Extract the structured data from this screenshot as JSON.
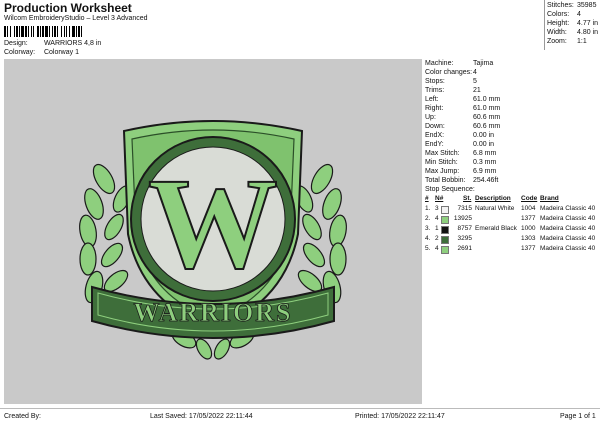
{
  "header": {
    "title": "Production Worksheet",
    "subtitle": "Wilcom EmbroideryStudio – Level 3 Advanced",
    "design_label": "Design:",
    "design_value": "WARRIORS 4,8 in",
    "colorway_label": "Colorway:",
    "colorway_value": "Colorway 1"
  },
  "stats": [
    {
      "label": "Stitches:",
      "value": "35985"
    },
    {
      "label": "Colors:",
      "value": "4"
    },
    {
      "label": "Height:",
      "value": "4.77 in"
    },
    {
      "label": "Width:",
      "value": "4.80 in"
    },
    {
      "label": "Zoom:",
      "value": "1:1"
    }
  ],
  "machine_info": [
    {
      "label": "Machine:",
      "value": "Tajima"
    },
    {
      "label": "Color changes:",
      "value": "4"
    },
    {
      "label": "Stops:",
      "value": "5"
    },
    {
      "label": "Trims:",
      "value": "21"
    },
    {
      "label": "Left:",
      "value": "61.0 mm"
    },
    {
      "label": "Right:",
      "value": "61.0 mm"
    },
    {
      "label": "Up:",
      "value": "60.6 mm"
    },
    {
      "label": "Down:",
      "value": "60.6 mm"
    },
    {
      "label": "EndX:",
      "value": "0.00 in"
    },
    {
      "label": "EndY:",
      "value": "0.00 in"
    },
    {
      "label": "Max Stitch:",
      "value": "6.8 mm"
    },
    {
      "label": "Min Stitch:",
      "value": "0.3 mm"
    },
    {
      "label": "Max Jump:",
      "value": "6.9 mm"
    },
    {
      "label": "Total Bobbin:",
      "value": "254.46ft"
    }
  ],
  "stop_sequence": {
    "title": "Stop Sequence:",
    "headers": {
      "num": "#",
      "n": "N#",
      "st": "St.",
      "description": "Description",
      "code": "Code",
      "brand": "Brand"
    },
    "rows": [
      {
        "num": "1.",
        "n": "3",
        "color": "#f2f2f2",
        "st": "7315",
        "description": "Natural White",
        "code": "1004",
        "brand": "Madeira Classic 40"
      },
      {
        "num": "2.",
        "n": "4",
        "color": "#8ecf7e",
        "st": "13925",
        "description": "",
        "code": "1377",
        "brand": "Madeira Classic 40"
      },
      {
        "num": "3.",
        "n": "1",
        "color": "#111111",
        "st": "8757",
        "description": "Emerald Black",
        "code": "1000",
        "brand": "Madeira Classic 40"
      },
      {
        "num": "4.",
        "n": "2",
        "color": "#3e6e3a",
        "st": "3295",
        "description": "",
        "code": "1303",
        "brand": "Madeira Classic 40"
      },
      {
        "num": "5.",
        "n": "4",
        "color": "#8ecf7e",
        "st": "2691",
        "description": "",
        "code": "1377",
        "brand": "Madeira Classic 40"
      }
    ]
  },
  "design": {
    "banner_text": "WARRIORS",
    "monogram": "W"
  },
  "footer": {
    "created_by": "Created By:",
    "last_saved": "Last Saved: 17/05/2022 22:11:44",
    "printed": "Printed: 17/05/2022 22:11:47",
    "page": "Page 1 of 1"
  },
  "colors": {
    "light_green": "#8ecf7e",
    "dark_green": "#3e6e3a",
    "bg_gray": "#c9c9c9",
    "circle_fill": "#d9dcd6"
  }
}
